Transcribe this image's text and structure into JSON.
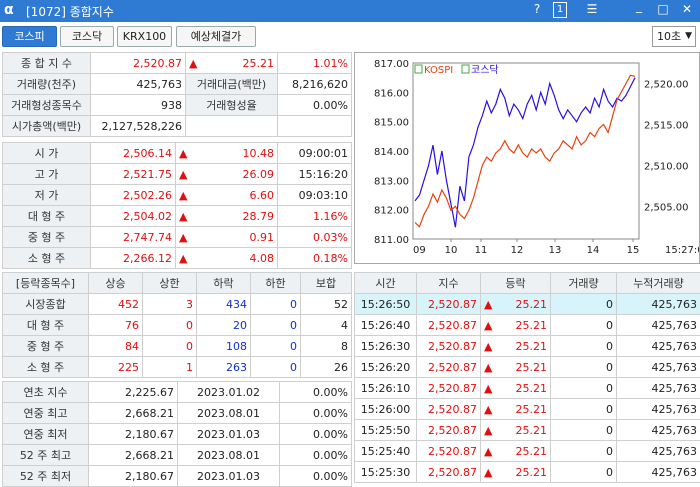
{
  "window": {
    "logo": "α",
    "title": "[1072] 종합지수",
    "help": "?",
    "one": "1",
    "menu": "☰",
    "minimize": "_",
    "maximize": "□",
    "close": "✕"
  },
  "tabs": [
    {
      "label": "코스피",
      "active": true
    },
    {
      "label": "코스닥"
    },
    {
      "label": "KRX100"
    },
    {
      "label": "예상체결가"
    }
  ],
  "interval": {
    "value": "10초"
  },
  "summary": {
    "index_label": "종 합 지 수",
    "index_value": "2,520.87",
    "arrow": "▲",
    "change": "25.21",
    "change_pct": "1.01%",
    "volume_label": "거래량(천주)",
    "volume": "425,763",
    "amount_label": "거래대금(백만)",
    "amount": "8,216,620",
    "formed_count_label": "거래형성종목수",
    "formed_count": "938",
    "formed_rate_label": "거래형성율",
    "formed_rate": "0.00%",
    "mcap_label": "시가총액(백만)",
    "mcap": "2,127,528,226"
  },
  "ohlc": [
    {
      "label": "시   가",
      "value": "2,506.14",
      "arrow": "▲",
      "change": "10.48",
      "right": "09:00:01",
      "rcolor": "blk"
    },
    {
      "label": "고   가",
      "value": "2,521.75",
      "arrow": "▲",
      "change": "26.09",
      "right": "15:16:20",
      "rcolor": "blk"
    },
    {
      "label": "저   가",
      "value": "2,502.26",
      "arrow": "▲",
      "change": "6.60",
      "right": "09:03:10",
      "rcolor": "blk"
    },
    {
      "label": "대 형 주",
      "value": "2,504.02",
      "arrow": "▲",
      "change": "28.79",
      "right": "1.16%",
      "rcolor": "red"
    },
    {
      "label": "중 형 주",
      "value": "2,747.74",
      "arrow": "▲",
      "change": "0.91",
      "right": "0.03%",
      "rcolor": "red"
    },
    {
      "label": "소 형 주",
      "value": "2,266.12",
      "arrow": "▲",
      "change": "4.08",
      "right": "0.18%",
      "rcolor": "red"
    }
  ],
  "breadth": {
    "headers": [
      "[등락종목수]",
      "상승",
      "상한",
      "하락",
      "하한",
      "보합"
    ],
    "rows": [
      {
        "label": "시장종합",
        "up": "452",
        "uplim": "3",
        "down": "434",
        "downlim": "0",
        "flat": "52"
      },
      {
        "label": "대 형 주",
        "up": "76",
        "uplim": "0",
        "down": "20",
        "downlim": "0",
        "flat": "4"
      },
      {
        "label": "중 형 주",
        "up": "84",
        "uplim": "0",
        "down": "108",
        "downlim": "0",
        "flat": "8"
      },
      {
        "label": "소 형 주",
        "up": "225",
        "uplim": "1",
        "down": "263",
        "downlim": "0",
        "flat": "26"
      }
    ]
  },
  "yearly": [
    {
      "label": "연초  지수",
      "value": "2,225.67",
      "date": "2023.01.02",
      "pct": "0.00%"
    },
    {
      "label": "연중  최고",
      "value": "2,668.21",
      "date": "2023.08.01",
      "pct": "0.00%"
    },
    {
      "label": "연중  최저",
      "value": "2,180.67",
      "date": "2023.01.03",
      "pct": "0.00%"
    },
    {
      "label": "52 주 최고",
      "value": "2,668.21",
      "date": "2023.08.01",
      "pct": "0.00%"
    },
    {
      "label": "52 주 최저",
      "value": "2,180.67",
      "date": "2023.01.03",
      "pct": "0.00%"
    }
  ],
  "ticks": {
    "headers": [
      "시간",
      "지수",
      "등락",
      "거래량",
      "누적거래량"
    ],
    "rows": [
      {
        "time": "15:26:50",
        "index": "2,520.87",
        "arrow": "▲",
        "change": "25.21",
        "vol": "0",
        "cum": "425,763"
      },
      {
        "time": "15:26:40",
        "index": "2,520.87",
        "arrow": "▲",
        "change": "25.21",
        "vol": "0",
        "cum": "425,763"
      },
      {
        "time": "15:26:30",
        "index": "2,520.87",
        "arrow": "▲",
        "change": "25.21",
        "vol": "0",
        "cum": "425,763"
      },
      {
        "time": "15:26:20",
        "index": "2,520.87",
        "arrow": "▲",
        "change": "25.21",
        "vol": "0",
        "cum": "425,763"
      },
      {
        "time": "15:26:10",
        "index": "2,520.87",
        "arrow": "▲",
        "change": "25.21",
        "vol": "0",
        "cum": "425,763"
      },
      {
        "time": "15:26:00",
        "index": "2,520.87",
        "arrow": "▲",
        "change": "25.21",
        "vol": "0",
        "cum": "425,763"
      },
      {
        "time": "15:25:50",
        "index": "2,520.87",
        "arrow": "▲",
        "change": "25.21",
        "vol": "0",
        "cum": "425,763"
      },
      {
        "time": "15:25:40",
        "index": "2,520.87",
        "arrow": "▲",
        "change": "25.21",
        "vol": "0",
        "cum": "425,763"
      },
      {
        "time": "15:25:30",
        "index": "2,520.87",
        "arrow": "▲",
        "change": "25.21",
        "vol": "0",
        "cum": "425,763"
      }
    ]
  },
  "colors": {
    "up": "#e01010",
    "down": "#1030d0",
    "kospi_line": "#e8420f",
    "kosdaq_line": "#2a10e0",
    "accent": "#2f7bd4"
  },
  "chart_data": {
    "type": "line",
    "series": [
      {
        "name": "KOSPI",
        "axis": "right",
        "color": "#e8420f"
      },
      {
        "name": "코스닥",
        "axis": "left",
        "color": "#2a10e0"
      }
    ],
    "left_ticks": [
      "817.00",
      "816.00",
      "815.00",
      "814.00",
      "813.00",
      "812.00",
      "811.00"
    ],
    "left_range": [
      811,
      817
    ],
    "right_ticks": [
      "2,520.00",
      "2,515.00",
      "2,510.00",
      "2,505.00"
    ],
    "right_range": [
      2501,
      2522.5
    ],
    "x_ticks": [
      "09",
      "10",
      "11",
      "12",
      "13",
      "14",
      "15",
      "15:27:00"
    ],
    "kospi": [
      2503,
      2502.5,
      2504,
      2505,
      2506.5,
      2505.5,
      2507,
      2506,
      2504.5,
      2505,
      2504,
      2503.5,
      2504.5,
      2506,
      2508,
      2510,
      2511,
      2510.5,
      2511.5,
      2512,
      2513,
      2512,
      2511.5,
      2512.5,
      2511.5,
      2511,
      2512,
      2511.5,
      2512,
      2511,
      2510.5,
      2511.5,
      2512,
      2513,
      2512.5,
      2512,
      2513.5,
      2512.5,
      2513,
      2514,
      2513.5,
      2514.5,
      2515,
      2514,
      2516,
      2518,
      2519,
      2520,
      2521,
      2520.87
    ],
    "kosdaq": [
      812.3,
      812.5,
      813,
      813.5,
      814.2,
      813.2,
      814,
      813,
      812.2,
      811.4,
      812.8,
      812.3,
      813.8,
      814.2,
      814.8,
      815.2,
      815.7,
      815.3,
      815.6,
      816.1,
      815.8,
      815.2,
      815.6,
      815.4,
      815.1,
      815.6,
      815.9,
      815.4,
      816,
      815.6,
      816.3,
      815.9,
      815.4,
      815.1,
      815.4,
      815.2,
      815,
      815.3,
      815.5,
      815.3,
      815.8,
      815.5,
      816.1,
      815.7,
      815.5,
      815.8,
      815.7,
      815.9,
      816.2,
      816.5
    ]
  }
}
